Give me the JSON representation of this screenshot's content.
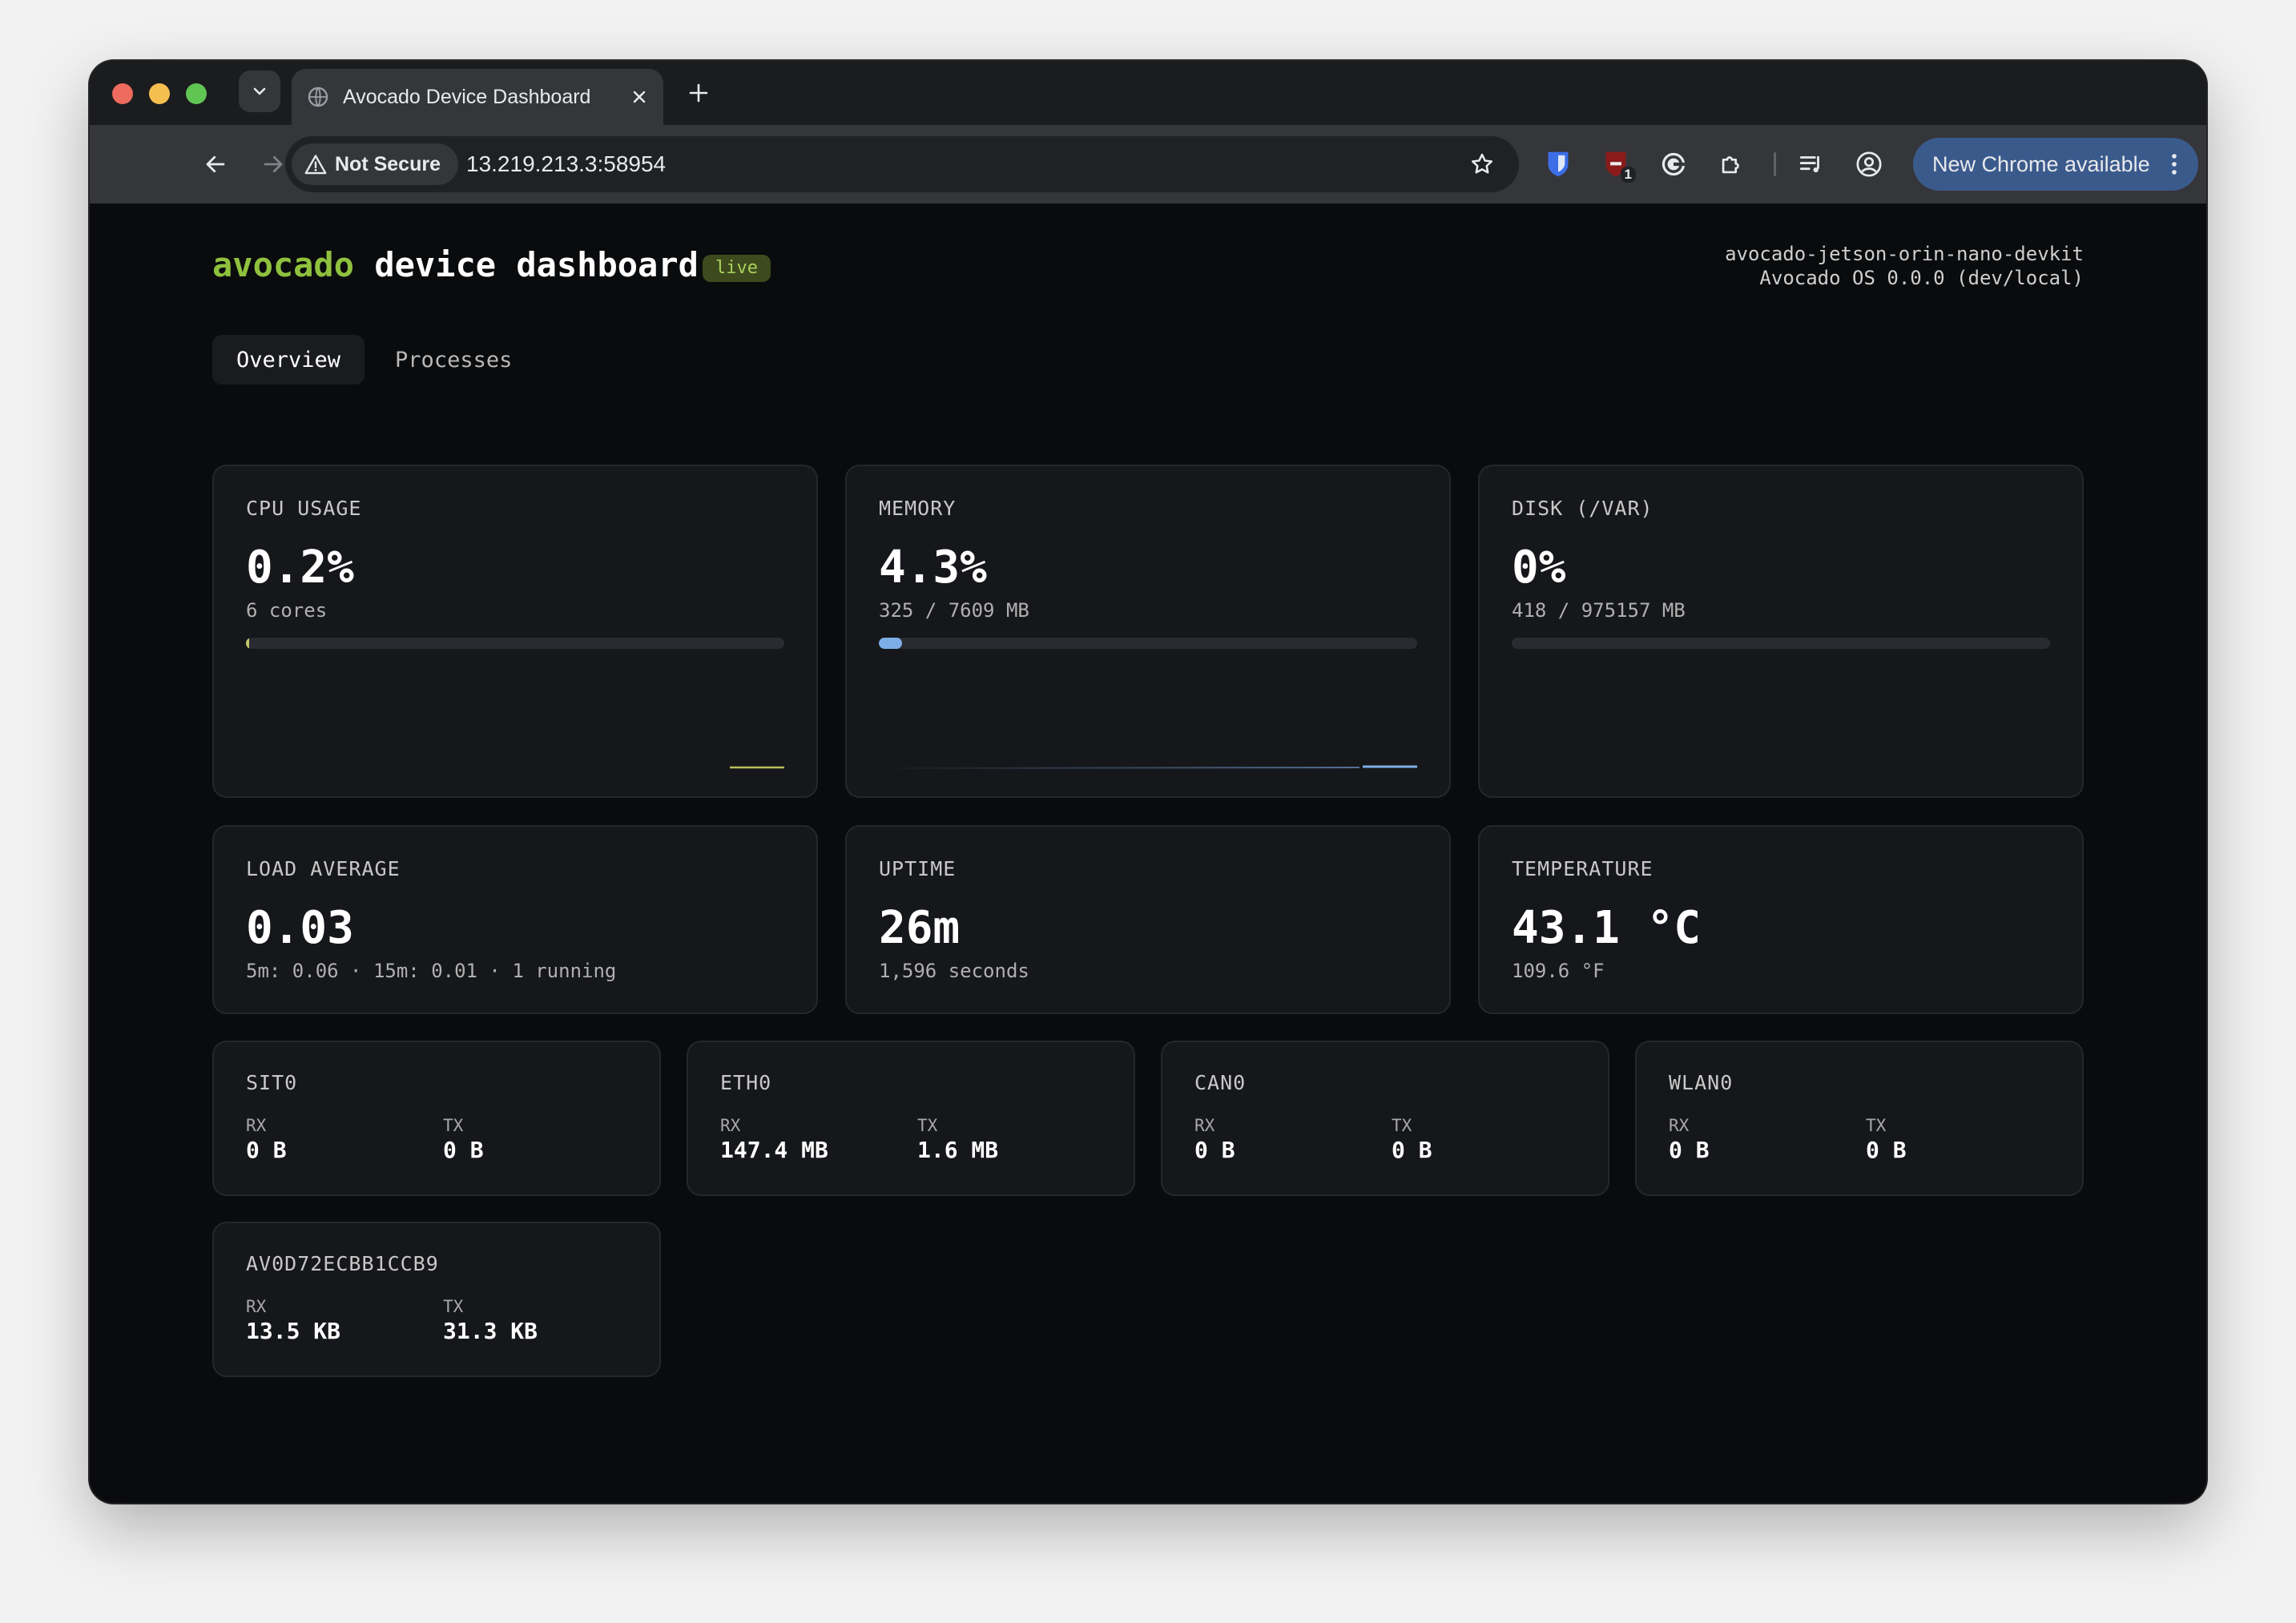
{
  "browser": {
    "tab_title": "Avocado Device Dashboard",
    "security_label": "Not Secure",
    "url": "13.219.213.3:58954",
    "extension_badge": "1",
    "update_button": "New Chrome available"
  },
  "header": {
    "brand_accent": "avocado",
    "brand_rest": "device dashboard",
    "live_badge": "live",
    "hostname": "avocado-jetson-orin-nano-devkit",
    "os_version": "Avocado OS 0.0.0 (dev/local)"
  },
  "nav": {
    "tabs": [
      "Overview",
      "Processes"
    ],
    "active": "Overview"
  },
  "metrics": {
    "cpu": {
      "label": "CPU USAGE",
      "value": "0.2%",
      "sub": "6 cores",
      "fraction": 0.002,
      "color": "#c4c96a"
    },
    "memory": {
      "label": "MEMORY",
      "value": "4.3%",
      "sub": "325 / 7609 MB",
      "fraction": 0.043,
      "color": "#7eaee8"
    },
    "disk": {
      "label": "DISK (/VAR)",
      "value": "0%",
      "sub": "418 / 975157 MB",
      "fraction": 0.0,
      "color": "#7eaee8"
    },
    "load": {
      "label": "LOAD AVERAGE",
      "value": "0.03",
      "sub": "5m: 0.06 · 15m: 0.01 · 1 running"
    },
    "uptime": {
      "label": "UPTIME",
      "value": "26m",
      "sub": "1,596 seconds"
    },
    "temperature": {
      "label": "TEMPERATURE",
      "value": "43.1 °C",
      "sub": "109.6 °F"
    }
  },
  "network": {
    "rx_label": "RX",
    "tx_label": "TX",
    "interfaces": [
      {
        "name": "SIT0",
        "rx": "0 B",
        "tx": "0 B"
      },
      {
        "name": "ETH0",
        "rx": "147.4 MB",
        "tx": "1.6 MB"
      },
      {
        "name": "CAN0",
        "rx": "0 B",
        "tx": "0 B"
      },
      {
        "name": "WLAN0",
        "rx": "0 B",
        "tx": "0 B"
      },
      {
        "name": "AV0D72ECBB1CCB9",
        "rx": "13.5 KB",
        "tx": "31.3 KB"
      }
    ]
  }
}
